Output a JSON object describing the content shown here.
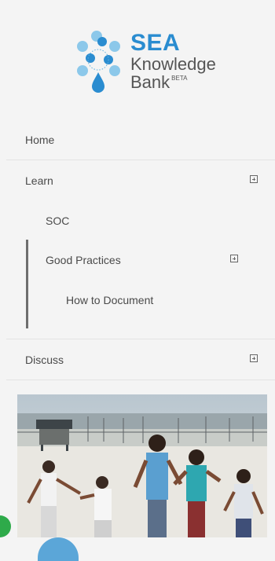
{
  "logo": {
    "line1": "SEA",
    "line2": "Knowledge",
    "line3": "Bank",
    "beta": "BETA"
  },
  "nav": {
    "home": "Home",
    "learn": "Learn",
    "soc": "SOC",
    "good_practices": "Good Practices",
    "how_to_document": "How to Document",
    "discuss": "Discuss"
  },
  "colors": {
    "brand_blue": "#2a8cd0",
    "accent_bar": "#6e6e6e",
    "background": "#f4f4f4"
  }
}
